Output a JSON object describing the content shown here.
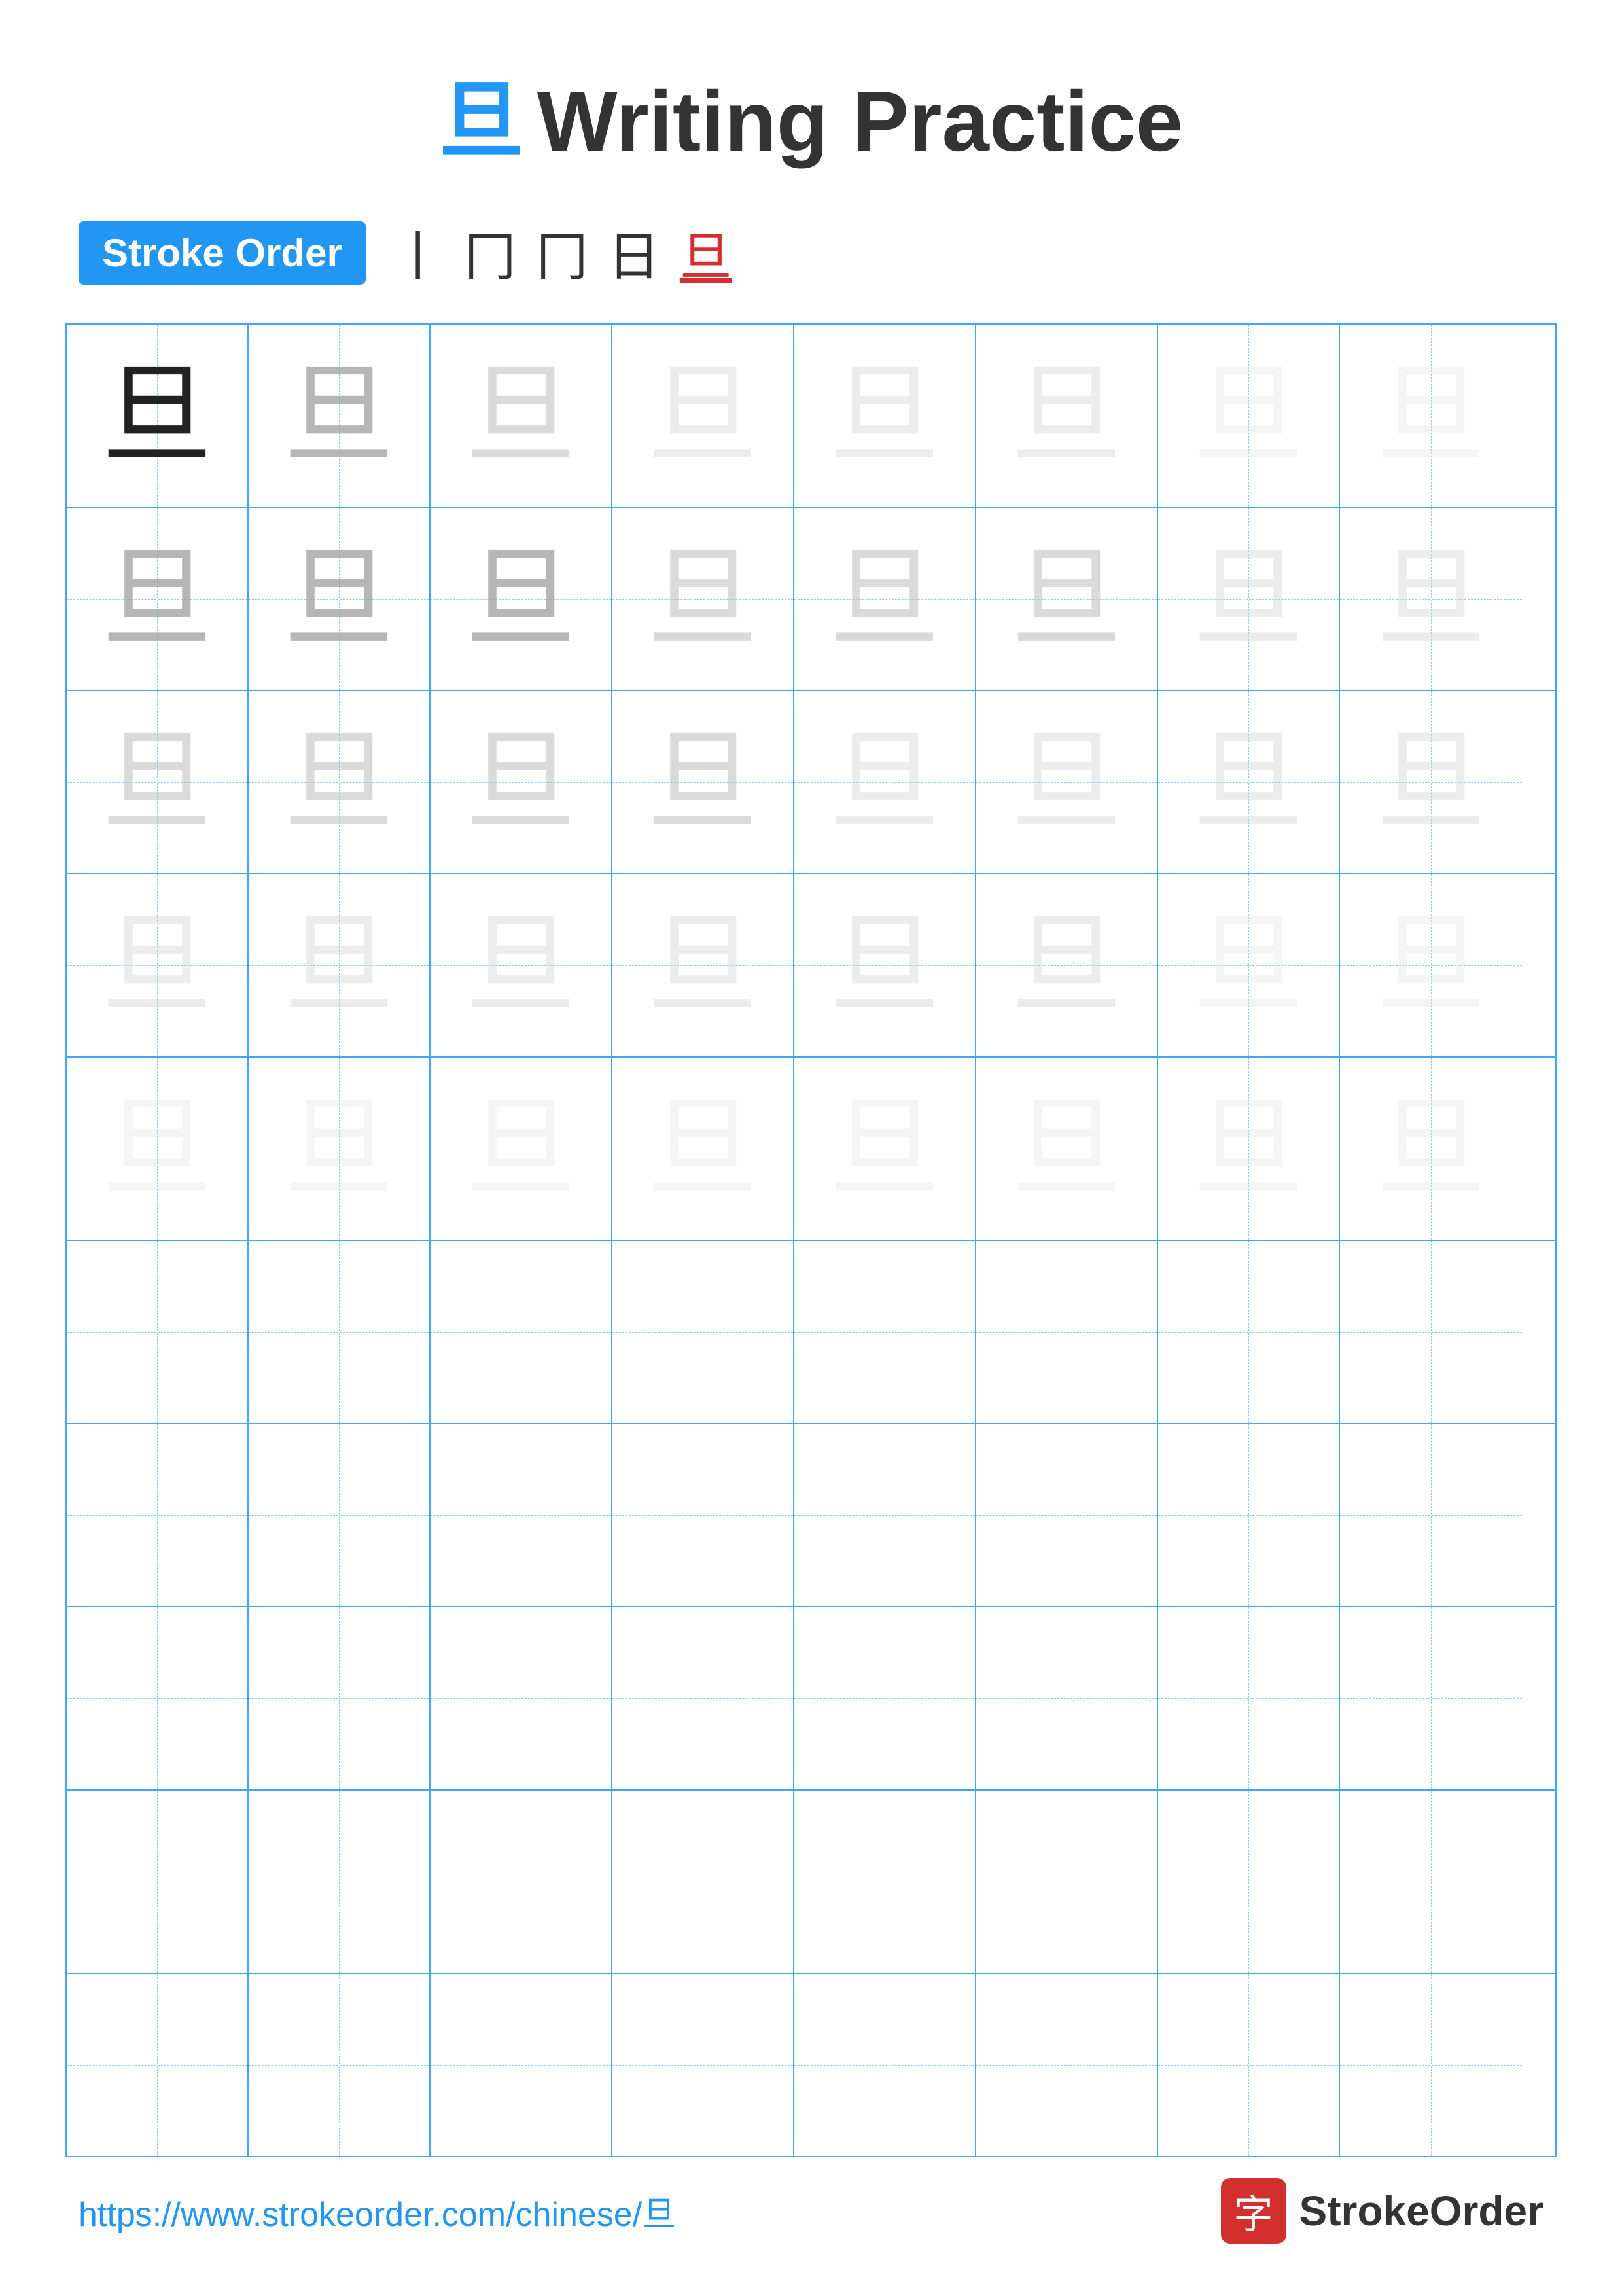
{
  "header": {
    "char": "旦",
    "title": "Writing Practice"
  },
  "stroke_order": {
    "badge": "Stroke Order",
    "strokes": [
      "丨",
      "冂",
      "冂",
      "日",
      "旦"
    ]
  },
  "grid": {
    "rows": 10,
    "cols": 8
  },
  "footer": {
    "url": "https://www.strokeorder.com/chinese/旦",
    "brand_icon": "字",
    "brand_name": "StrokeOrder"
  }
}
